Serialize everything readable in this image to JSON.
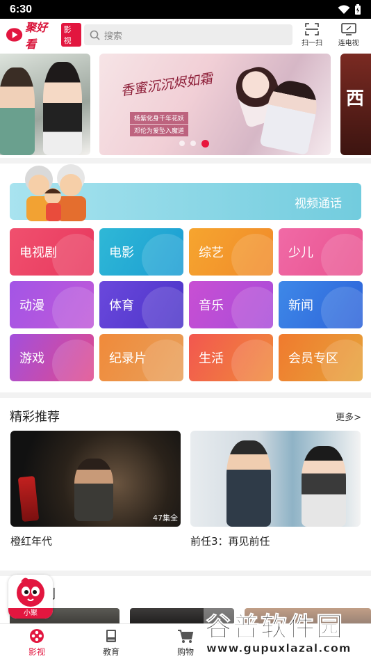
{
  "status_bar": {
    "time": "6:30"
  },
  "header": {
    "logo_text": "聚好看",
    "logo_badge": "影视",
    "search_placeholder": "搜索",
    "scan_label": "扫一扫",
    "tv_label": "连电视"
  },
  "banner": {
    "main_title": "香蜜沉沉烬如霜",
    "main_sub_1": "杨紫化身千年花妖",
    "main_sub_2": "邓伦为爱坠入魔道",
    "right_text": "西",
    "slide_count": 3,
    "active_slide": 3
  },
  "video_call": {
    "label": "视频通话"
  },
  "categories": [
    {
      "label": "电视剧",
      "color_from": "#f0506e",
      "color_to": "#e8385e"
    },
    {
      "label": "电影",
      "color_from": "#2fb8d6",
      "color_to": "#1b9dd3"
    },
    {
      "label": "综艺",
      "color_from": "#f6a52f",
      "color_to": "#f08a2a"
    },
    {
      "label": "少儿",
      "color_from": "#f06aa6",
      "color_to": "#e9528f"
    },
    {
      "label": "动漫",
      "color_from": "#a355e6",
      "color_to": "#c059d8"
    },
    {
      "label": "体育",
      "color_from": "#6a48dc",
      "color_to": "#4c34c8"
    },
    {
      "label": "音乐",
      "color_from": "#c84fd3",
      "color_to": "#a94cd9"
    },
    {
      "label": "新闻",
      "color_from": "#3e88e8",
      "color_to": "#2d63d9"
    },
    {
      "label": "游戏",
      "color_from": "#a34fdc",
      "color_to": "#e04a8c"
    },
    {
      "label": "纪录片",
      "color_from": "#f08a3a",
      "color_to": "#e8a05a"
    },
    {
      "label": "生活",
      "color_from": "#f2574f",
      "color_to": "#f08a3a"
    },
    {
      "label": "会员专区",
      "color_from": "#f07a2e",
      "color_to": "#e6a33a"
    }
  ],
  "recommend": {
    "title": "精彩推荐",
    "more": "更多>",
    "items": [
      {
        "title": "橙红年代",
        "badge": "47集全"
      },
      {
        "title": "前任3：再见前任",
        "badge": ""
      }
    ]
  },
  "hot": {
    "title_visible": "剧"
  },
  "mascot": {
    "label": "小聚"
  },
  "bottom_nav": [
    {
      "label": "影视",
      "icon": "film-reel-icon",
      "active": true
    },
    {
      "label": "教育",
      "icon": "book-icon",
      "active": false
    },
    {
      "label": "购物",
      "icon": "cart-icon",
      "active": false
    }
  ],
  "watermark": {
    "big": "谷普软件园",
    "small": "www.gupuxlazal.com"
  }
}
